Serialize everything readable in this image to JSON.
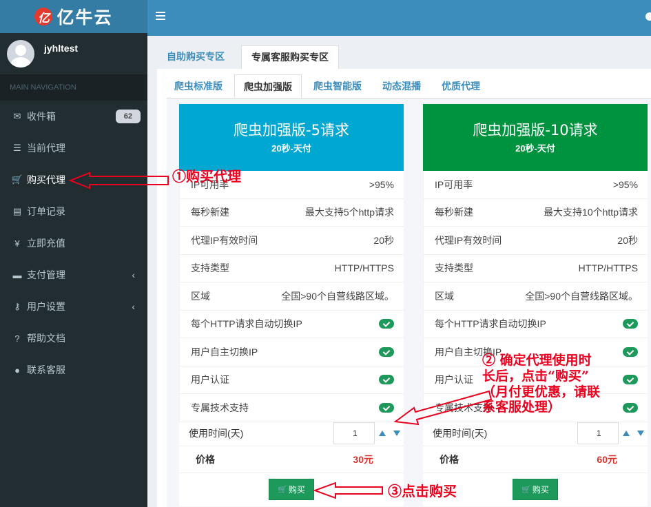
{
  "brand": {
    "logo_mark": "亿",
    "name": "亿牛云"
  },
  "user": {
    "name": "jyhltest"
  },
  "nav": {
    "header": "MAIN NAVIGATION",
    "items": [
      {
        "label": "收件箱",
        "icon": "envelope-icon",
        "glyph": "✉",
        "badge": "62"
      },
      {
        "label": "当前代理",
        "icon": "list-icon",
        "glyph": "☰"
      },
      {
        "label": "购买代理",
        "icon": "cart-icon",
        "glyph": "🛒"
      },
      {
        "label": "订单记录",
        "icon": "receipt-icon",
        "glyph": "▤"
      },
      {
        "label": "立即充值",
        "icon": "yen-icon",
        "glyph": "¥"
      },
      {
        "label": "支付管理",
        "icon": "credit-card-icon",
        "glyph": "▬",
        "chevron": "‹"
      },
      {
        "label": "用户设置",
        "icon": "key-icon",
        "glyph": "⚷",
        "chevron": "‹"
      },
      {
        "label": "帮助文档",
        "icon": "question-icon",
        "glyph": "?"
      },
      {
        "label": "联系客服",
        "icon": "user-icon",
        "glyph": "●"
      }
    ]
  },
  "top_tabs": [
    "自助购买专区",
    "专属客服购买专区"
  ],
  "sub_tabs": [
    "爬虫标准版",
    "爬虫加强版",
    "爬虫智能版",
    "动态混播",
    "优质代理"
  ],
  "cards": [
    {
      "title": "爬虫加强版-5请求",
      "subtitle": "20秒-天付",
      "header_color": "#00a7d0",
      "features": [
        {
          "label": "IP可用率",
          "value": ">95%"
        },
        {
          "label": "每秒新建",
          "value": "最大支持5个http请求"
        },
        {
          "label": "代理IP有效时间",
          "value": "20秒"
        },
        {
          "label": "支持类型",
          "value": "HTTP/HTTPS"
        },
        {
          "label": "区域",
          "value": "全国>90个自营线路区域。"
        },
        {
          "label": "每个HTTP请求自动切换IP",
          "check": true
        },
        {
          "label": "用户自主切换IP",
          "check": true
        },
        {
          "label": "用户认证",
          "check": true
        },
        {
          "label": "专属技术支持",
          "check": true
        }
      ],
      "duration_label": "使用时间(天)",
      "quantity": "1",
      "price_label": "价格",
      "price": "30元",
      "buy_label": "购买"
    },
    {
      "title": "爬虫加强版-10请求",
      "subtitle": "20秒-天付",
      "header_color": "#00933f",
      "features": [
        {
          "label": "IP可用率",
          "value": ">95%"
        },
        {
          "label": "每秒新建",
          "value": "最大支持10个http请求"
        },
        {
          "label": "代理IP有效时间",
          "value": "20秒"
        },
        {
          "label": "支持类型",
          "value": "HTTP/HTTPS"
        },
        {
          "label": "区域",
          "value": "全国>90个自营线路区域。"
        },
        {
          "label": "每个HTTP请求自动切换IP",
          "check": true
        },
        {
          "label": "用户自主切换IP",
          "check": true
        },
        {
          "label": "用户认证",
          "check": true
        },
        {
          "label": "专属技术支持",
          "check": true
        }
      ],
      "duration_label": "使用时间(天)",
      "quantity": "1",
      "price_label": "价格",
      "price": "60元",
      "buy_label": "购买"
    }
  ],
  "annotations": {
    "step1": "①购买代理",
    "step2": [
      "② 确定代理使用时",
      "长后，点击“购买”",
      "（月付更优惠，请联",
      "系客服处理）"
    ],
    "step3": "③点击购买",
    "color": "#e8001e"
  }
}
